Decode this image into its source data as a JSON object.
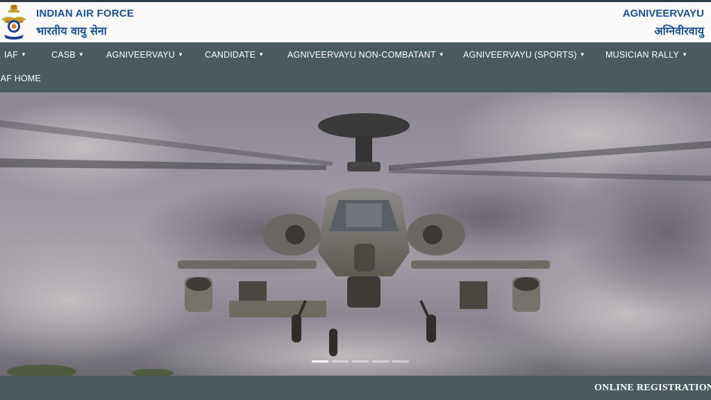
{
  "header": {
    "title_en": "INDIAN AIR FORCE",
    "title_hi": "भारतीय वायु सेना",
    "right_en": "AGNIVEERVAYU",
    "right_hi": "अग्निवीरवायु",
    "logo_icon": "iaf-emblem-icon"
  },
  "nav": {
    "items": [
      {
        "label": "IAF",
        "dropdown": true
      },
      {
        "label": "CASB",
        "dropdown": true
      },
      {
        "label": "AGNIVEERVAYU",
        "dropdown": true
      },
      {
        "label": "CANDIDATE",
        "dropdown": true
      },
      {
        "label": "AGNIVEERVAYU NON-COMBATANT",
        "dropdown": true
      },
      {
        "label": "AGNIVEERVAYU (SPORTS)",
        "dropdown": true
      },
      {
        "label": "MUSICIAN RALLY",
        "dropdown": true
      }
    ],
    "row2_item": "IAF HOME",
    "caret_icon": "caret-down-icon"
  },
  "hero": {
    "image": "attack-helicopter-photo",
    "slide_count": 5,
    "active_slide": 1
  },
  "ticker": {
    "text": "ONLINE REGISTRATION"
  },
  "colors": {
    "nav_bg": "#4a5a5f",
    "brand_text": "#1b4f8f"
  }
}
